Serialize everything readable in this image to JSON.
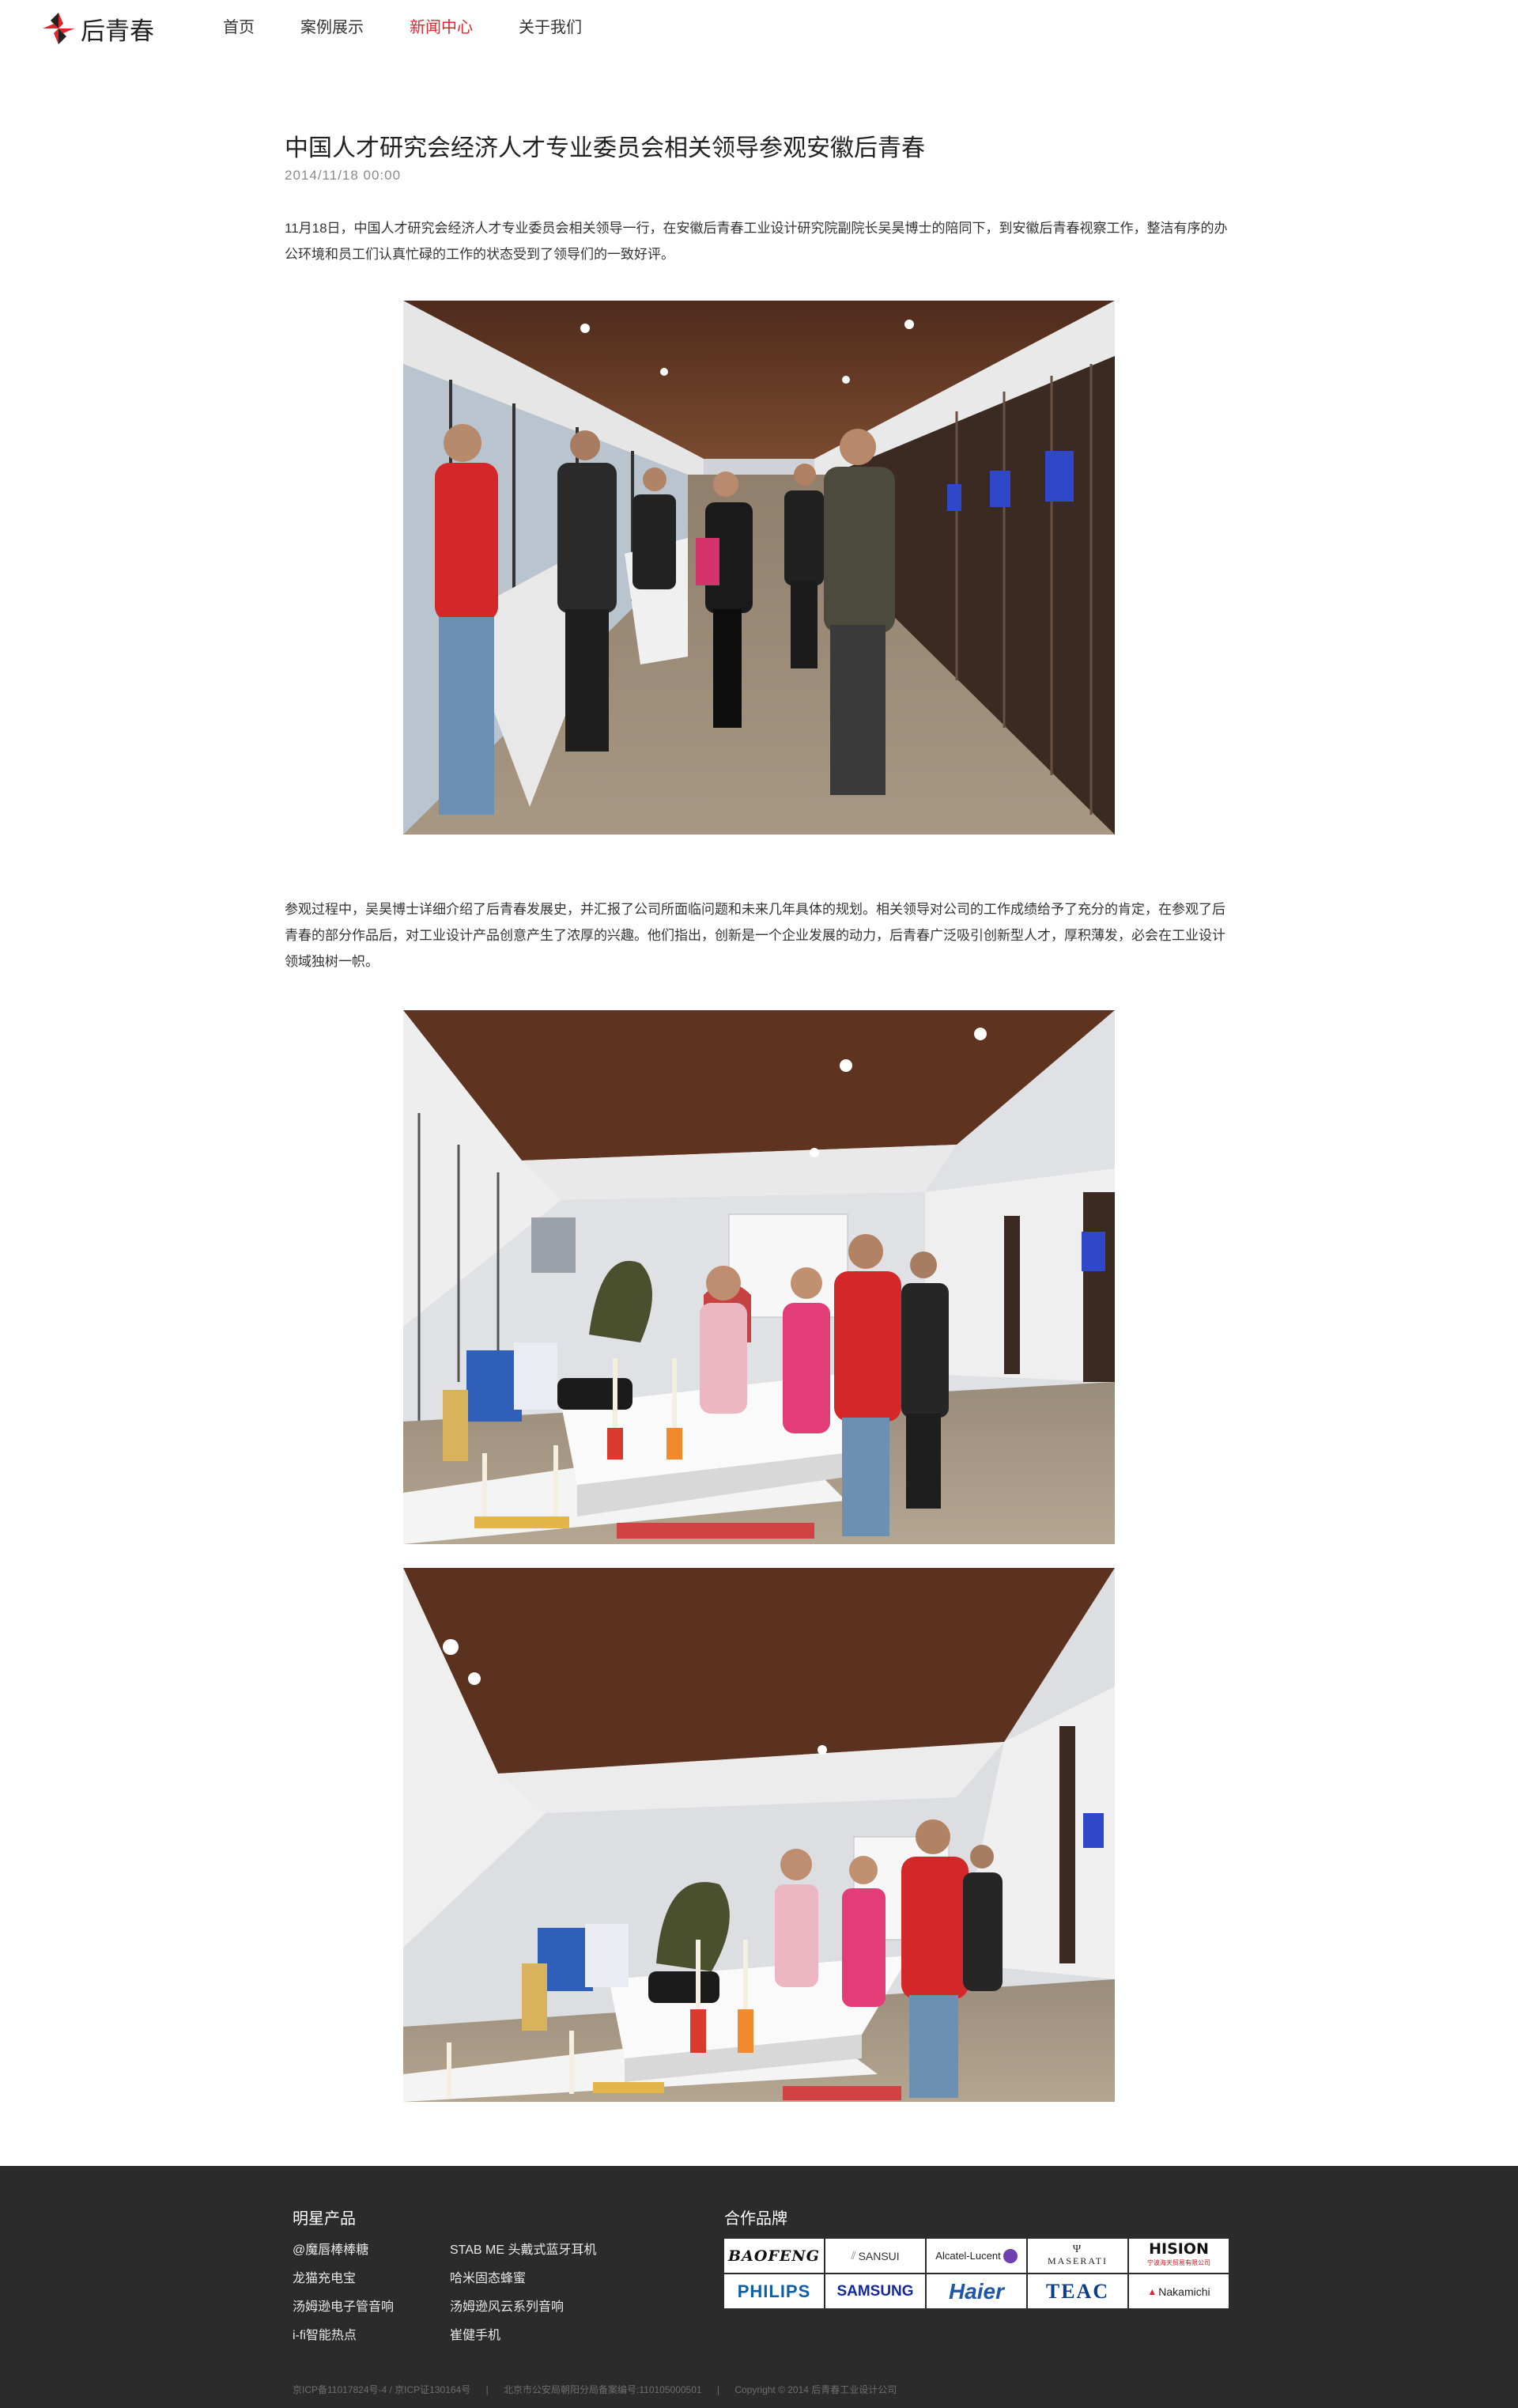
{
  "header": {
    "logo_text": "后青春",
    "nav": [
      {
        "label": "首页",
        "active": false
      },
      {
        "label": "案例展示",
        "active": false
      },
      {
        "label": "新闻中心",
        "active": true
      },
      {
        "label": "关于我们",
        "active": false
      }
    ],
    "accent_color": "#e3242b"
  },
  "article": {
    "title": "中国人才研究会经济人才专业委员会相关领导参观安徽后青春",
    "date": "2014/11/18  00:00",
    "paragraphs": [
      "11月18日，中国人才研究会经济人才专业委员会相关领导一行，在安徽后青春工业设计研究院副院长吴昊博士的陪同下，到安徽后青春视察工作，整洁有序的办公环境和员工们认真忙碌的工作的状态受到了领导们的一致好评。",
      "参观过程中，吴昊博士详细介绍了后青春发展史，并汇报了公司所面临问题和未来几年具体的规划。相关领导对公司的工作成绩给予了充分的肯定，在参观了后青春的部分作品后，对工业设计产品创意产生了浓厚的兴趣。他们指出，创新是一个企业发展的动力，后青春广泛吸引创新型人才，厚积薄发，必会在工业设计领域独树一帜。"
    ]
  },
  "footer": {
    "products_title": "明星产品",
    "products": [
      "@魔唇棒棒糖",
      "STAB ME 头戴式蓝牙耳机",
      "龙猫充电宝",
      "哈米固态蜂蜜",
      "汤姆逊电子管音响",
      "汤姆逊风云系列音响",
      "i-fi智能热点",
      "崔健手机"
    ],
    "brands_title": "合作品牌",
    "brands": [
      "BAOFENG",
      "SANSUI",
      "Alcatel-Lucent",
      "MASERATI",
      "HISION",
      "PHILIPS",
      "SAMSUNG",
      "Haier",
      "TEAC",
      "Nakamichi"
    ],
    "hision_sub": "宁波海天贸易有限公司",
    "copyright": [
      "京ICP备11017824号-4 / 京ICP证130164号",
      "|",
      "北京市公安局朝阳分局备案编号:110105000501",
      "|",
      "Copyright © 2014 后青春工业设计公司"
    ]
  }
}
